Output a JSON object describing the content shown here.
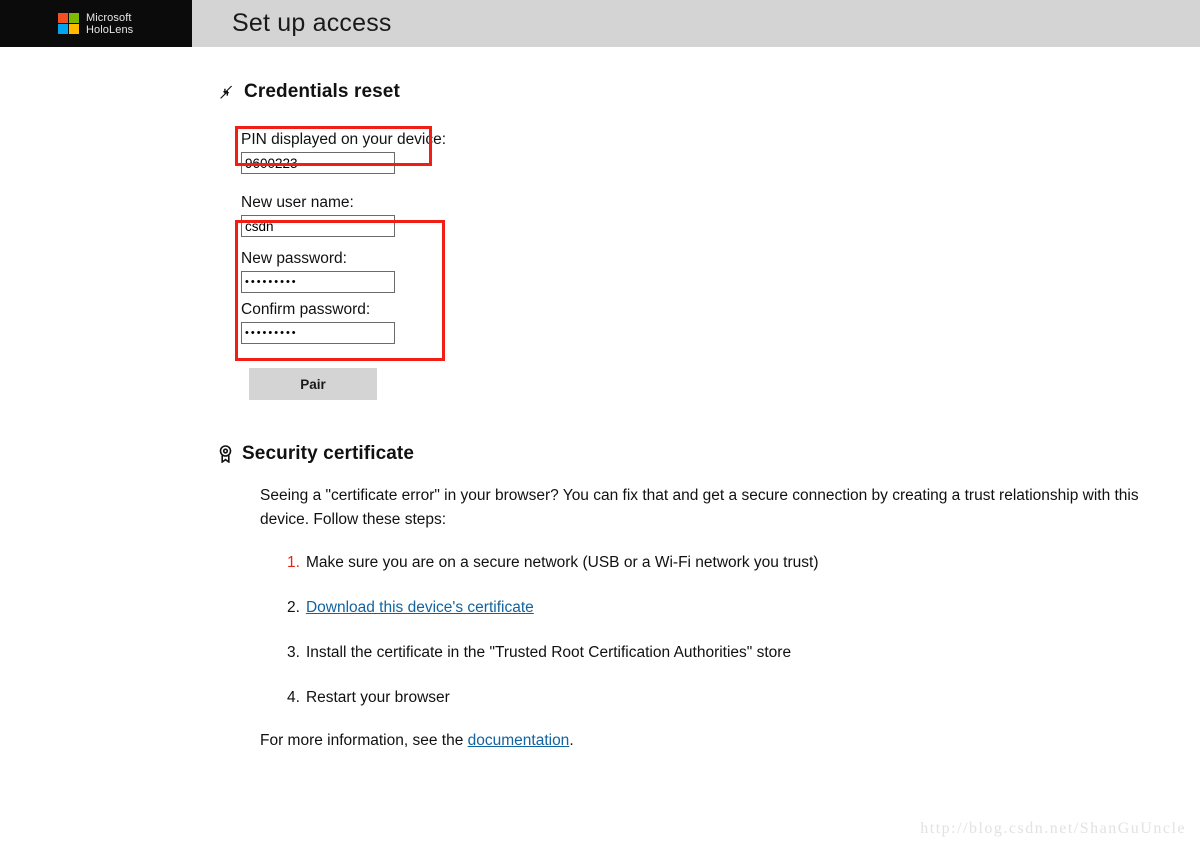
{
  "header": {
    "brand_line1": "Microsoft",
    "brand_line2": "HoloLens",
    "title": "Set up access",
    "logo_colors": {
      "red": "#f25022",
      "green": "#7fba00",
      "blue": "#00a4ef",
      "yellow": "#ffb900"
    },
    "bar_color": "#d4d4d4",
    "brand_bg": "#0b0b0b"
  },
  "credentials": {
    "heading": "Credentials reset",
    "heading_icon": "collapse-arrows-icon",
    "pin_label": "PIN displayed on your device:",
    "pin_value": "9600223",
    "username_label": "New user name:",
    "username_value": "csdn",
    "password_label": "New password:",
    "password_value": "•••••••••",
    "confirm_label": "Confirm password:",
    "confirm_value": "•••••••••",
    "pair_button": "Pair",
    "annotation_color": "#f01e14"
  },
  "certificate": {
    "heading": "Security certificate",
    "heading_icon": "certificate-seal-icon",
    "paragraph": "Seeing a \"certificate error\" in your browser? You can fix that and get a secure connection by creating a trust relationship with this device. Follow these steps:",
    "steps": [
      {
        "num": "1.",
        "text": "Make sure you are on a secure network (USB or a Wi-Fi network you trust)",
        "style": "warning"
      },
      {
        "num": "2.",
        "text": "",
        "link_text": "Download this device's certificate",
        "style": "link"
      },
      {
        "num": "3.",
        "text": "Install the certificate in the \"Trusted Root Certification Authorities\" store",
        "style": "normal"
      },
      {
        "num": "4.",
        "text": "Restart your browser",
        "style": "normal"
      }
    ],
    "footer_prefix": "For more information, see the ",
    "footer_link": "documentation",
    "footer_suffix": ".",
    "warning_color": "#e8231e",
    "link_color": "#1263a0"
  },
  "watermark": "http://blog.csdn.net/ShanGuUncle"
}
